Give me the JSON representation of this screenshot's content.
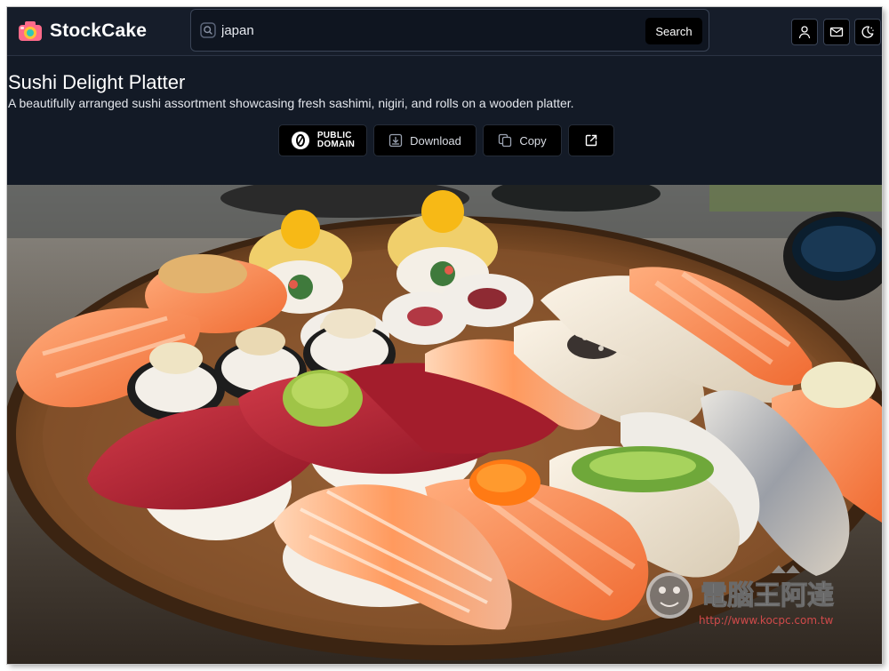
{
  "app": {
    "name": "StockCake",
    "logo_icon": "camera-icon"
  },
  "search": {
    "value": "japan",
    "button_label": "Search"
  },
  "nav": {
    "icons": [
      "user-icon",
      "mail-icon",
      "theme-toggle-icon"
    ]
  },
  "image": {
    "title": "Sushi Delight Platter",
    "description": "A beautifully arranged sushi assortment showcasing fresh sashimi, nigiri, and rolls on a wooden platter.",
    "alt": "Sushi Delight Platter"
  },
  "actions": {
    "license_line1": "PUBLIC",
    "license_line2": "DOMAIN",
    "download_label": "Download",
    "copy_label": "Copy"
  },
  "watermark": {
    "text": "電腦王阿達",
    "url": "http://www.kocpc.com.tw"
  },
  "colors": {
    "background": "#131a26",
    "button": "#000000",
    "text": "#ffffff",
    "logo_pink": "#ff6b8a",
    "logo_yellow": "#ffc234"
  }
}
